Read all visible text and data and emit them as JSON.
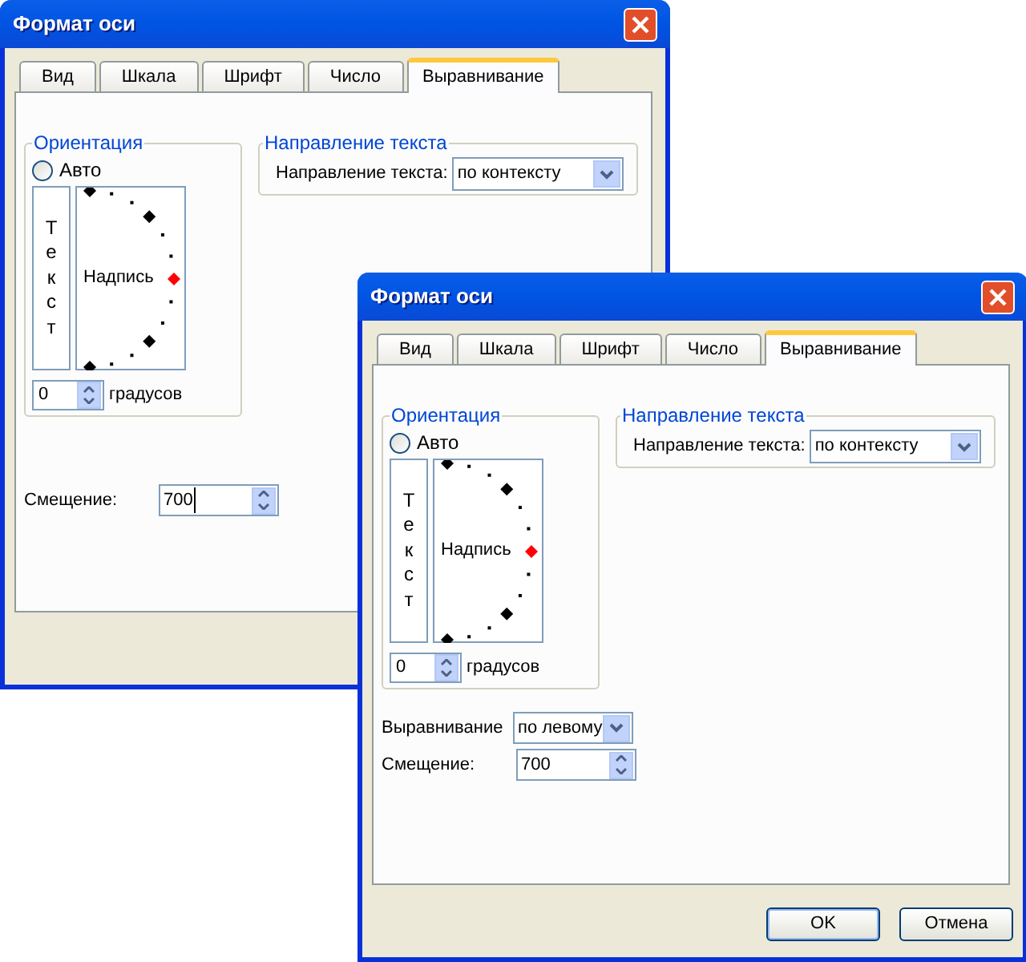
{
  "windows": [
    {
      "title": "Формат оси",
      "tabs": [
        {
          "label": "Вид",
          "selected": false
        },
        {
          "label": "Шкала",
          "selected": false
        },
        {
          "label": "Шрифт",
          "selected": false
        },
        {
          "label": "Число",
          "selected": false
        },
        {
          "label": "Выравнивание",
          "selected": true
        }
      ],
      "orientation": {
        "legend": "Ориентация",
        "auto": {
          "label": "Авто",
          "selected": false
        },
        "vertical_text": "Текст",
        "label": "Надпись",
        "degrees": {
          "value": "0",
          "unit": "градусов"
        }
      },
      "direction": {
        "legend": "Направление текста",
        "label": "Направление текста:",
        "value": "по контексту"
      },
      "offset": {
        "label": "Смещение:",
        "value": "700",
        "focused": true
      }
    },
    {
      "title": "Формат оси",
      "tabs": [
        {
          "label": "Вид",
          "selected": false
        },
        {
          "label": "Шкала",
          "selected": false
        },
        {
          "label": "Шрифт",
          "selected": false
        },
        {
          "label": "Число",
          "selected": false
        },
        {
          "label": "Выравнивание",
          "selected": true
        }
      ],
      "orientation": {
        "legend": "Ориентация",
        "auto": {
          "label": "Авто",
          "selected": false
        },
        "vertical_text": "Текст",
        "label": "Надпись",
        "degrees": {
          "value": "0",
          "unit": "градусов"
        }
      },
      "direction": {
        "legend": "Направление текста",
        "label": "Направление текста:",
        "value": "по контексту"
      },
      "alignment": {
        "label": "Выравнивание",
        "value": "по левому"
      },
      "offset": {
        "label": "Смещение:",
        "value": "700",
        "focused": false
      },
      "buttons": [
        "OK",
        "Отмена"
      ]
    }
  ]
}
